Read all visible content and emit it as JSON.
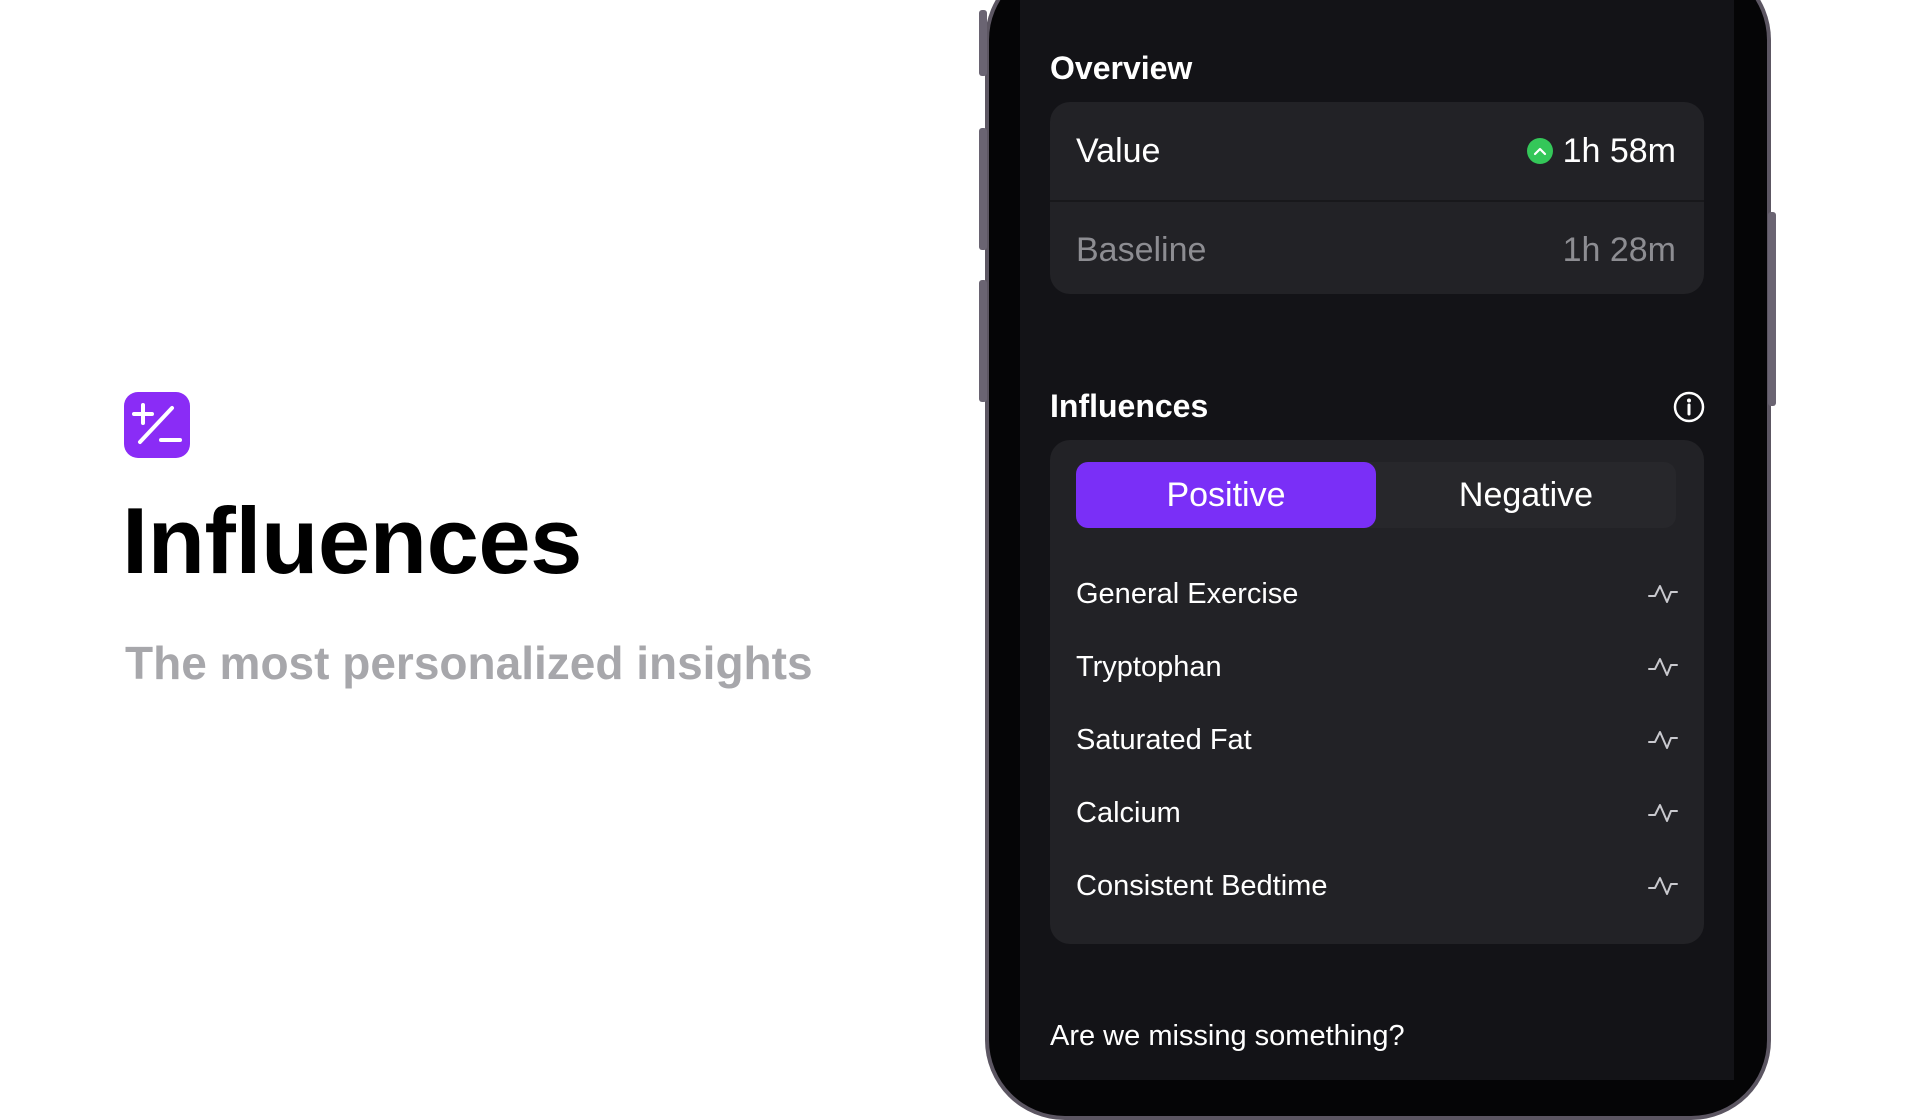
{
  "hero": {
    "icon": "plus-minus-icon",
    "title": "Influences",
    "subtitle": "The most personalized insights"
  },
  "overview": {
    "title": "Overview",
    "value_label": "Value",
    "value": "1h 58m",
    "value_trend": "up-arrow-icon",
    "baseline_label": "Baseline",
    "baseline": "1h 28m"
  },
  "influences": {
    "title": "Influences",
    "info_icon": "info-icon",
    "tabs": [
      "Positive",
      "Negative"
    ],
    "selected_tab": "Positive",
    "items": [
      {
        "label": "General Exercise",
        "icon": "trend-icon"
      },
      {
        "label": "Tryptophan",
        "icon": "trend-icon"
      },
      {
        "label": "Saturated Fat",
        "icon": "trend-icon"
      },
      {
        "label": "Calcium",
        "icon": "trend-icon"
      },
      {
        "label": "Consistent Bedtime",
        "icon": "trend-icon"
      }
    ]
  },
  "footer": {
    "question": "Are we missing something?"
  },
  "colors": {
    "accent": "#7a2ff7",
    "app_icon": "#8a2cf6",
    "positive": "#34c759",
    "screen_bg": "#131317",
    "card_bg": "#222226"
  }
}
